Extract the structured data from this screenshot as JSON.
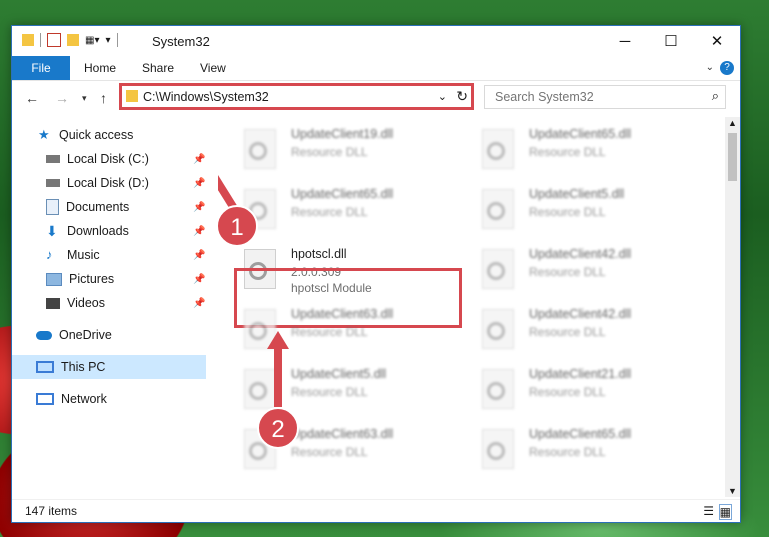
{
  "window": {
    "title": "System32",
    "minimize_glyph": "─",
    "maximize_glyph": "☐",
    "close_glyph": "✕"
  },
  "ribbon": {
    "tabs": [
      "File",
      "Home",
      "Share",
      "View"
    ]
  },
  "address": {
    "path": "C:\\Windows\\System32",
    "search_placeholder": "Search System32"
  },
  "sidebar": {
    "items": [
      {
        "label": "Quick access",
        "icon": "star-icon"
      },
      {
        "label": "Local Disk (C:)",
        "icon": "drive-icon"
      },
      {
        "label": "Local Disk (D:)",
        "icon": "drive-icon"
      },
      {
        "label": "Documents",
        "icon": "documents-icon"
      },
      {
        "label": "Downloads",
        "icon": "download-icon"
      },
      {
        "label": "Music",
        "icon": "music-icon"
      },
      {
        "label": "Pictures",
        "icon": "pictures-icon"
      },
      {
        "label": "Videos",
        "icon": "videos-icon"
      },
      {
        "label": "OneDrive",
        "icon": "cloud-icon"
      },
      {
        "label": "This PC",
        "icon": "computer-icon"
      },
      {
        "label": "Network",
        "icon": "network-icon"
      }
    ]
  },
  "files": {
    "left": [
      {
        "name": "UpdateClient19.dll",
        "desc": "Resource DLL"
      },
      {
        "name": "UpdateClient65.dll",
        "desc": "Resource DLL"
      },
      {
        "name": "UpdateClient63.dll",
        "desc": "Resource DLL"
      },
      {
        "name": "UpdateClient5.dll",
        "desc": "Resource DLL"
      },
      {
        "name": "UpdateClient63.dll",
        "desc": "Resource DLL"
      }
    ],
    "right": [
      {
        "name": "UpdateClient65.dll",
        "desc": "Resource DLL"
      },
      {
        "name": "UpdateClient5.dll",
        "desc": "Resource DLL"
      },
      {
        "name": "UpdateClient42.dll",
        "desc": "Resource DLL"
      },
      {
        "name": "UpdateClient42.dll",
        "desc": "Resource DLL"
      },
      {
        "name": "UpdateClient21.dll",
        "desc": "Resource DLL"
      },
      {
        "name": "UpdateClient65.dll",
        "desc": "Resource DLL"
      }
    ],
    "highlighted": {
      "name": "hpotscl.dll",
      "version": "2.0.0.309",
      "desc": "hpotscl Module"
    }
  },
  "callouts": {
    "one": "1",
    "two": "2"
  },
  "status": {
    "item_count": "147 items"
  },
  "colors": {
    "accent": "#1979ca",
    "highlight": "#d6484f",
    "selected": "#cce8ff"
  }
}
